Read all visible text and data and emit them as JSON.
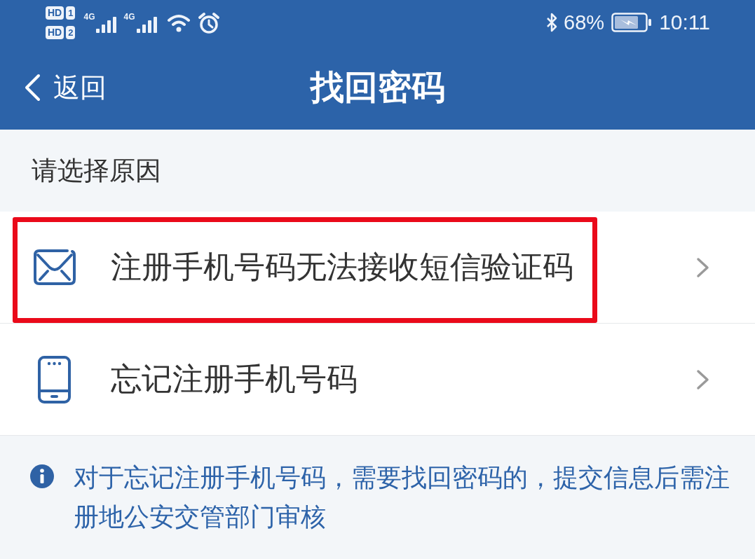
{
  "status_bar": {
    "sims": [
      {
        "badge": "HD",
        "slot": "1"
      },
      {
        "badge": "HD",
        "slot": "2"
      }
    ],
    "networks": [
      {
        "type": "4G"
      },
      {
        "type": "4G"
      }
    ],
    "battery": "68%",
    "time": "10:11"
  },
  "nav_bar": {
    "back": "返回",
    "title": "找回密码"
  },
  "reasons": {
    "heading": "请选择原因",
    "items": [
      {
        "kind": "sms",
        "label": "注册手机号码无法接收短信验证码",
        "highlighted": true
      },
      {
        "kind": "phone",
        "label": "忘记注册手机号码",
        "highlighted": false
      }
    ]
  },
  "notice": {
    "text": "对于忘记注册手机号码，需要找回密码的，提交信息后需注册地公安交管部门审核"
  }
}
